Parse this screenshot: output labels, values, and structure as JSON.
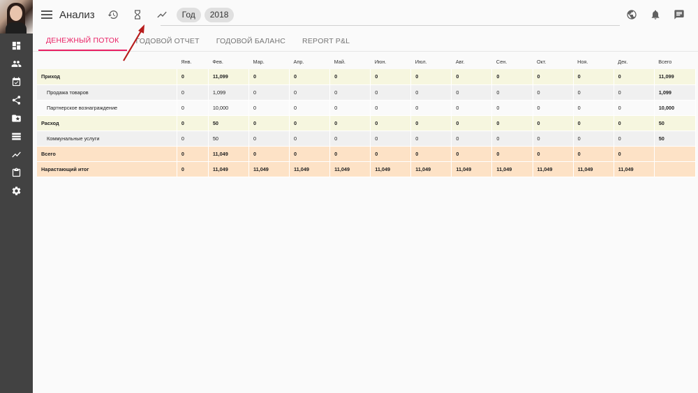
{
  "header": {
    "title": "Анализ",
    "chips": [
      "Год",
      "2018"
    ]
  },
  "tabs": [
    {
      "label": "ДЕНЕЖНЫЙ ПОТОК",
      "active": true
    },
    {
      "label": "ГОДОВОЙ ОТЧЕТ",
      "active": false
    },
    {
      "label": "ГОДОВОЙ БАЛАНС",
      "active": false
    },
    {
      "label": "REPORT P&L",
      "active": false
    }
  ],
  "table": {
    "columns": [
      "Янв.",
      "Фев.",
      "Мар.",
      "Апр.",
      "Май.",
      "Июн.",
      "Июл.",
      "Авг.",
      "Сен.",
      "Окт.",
      "Ноя.",
      "Дек.",
      "Всего"
    ],
    "rows": [
      {
        "label": "Приход",
        "kind": "cat",
        "values": [
          "0",
          "11,099",
          "0",
          "0",
          "0",
          "0",
          "0",
          "0",
          "0",
          "0",
          "0",
          "0",
          "11,099"
        ]
      },
      {
        "label": "Продажа товаров",
        "kind": "sub",
        "values": [
          "0",
          "1,099",
          "0",
          "0",
          "0",
          "0",
          "0",
          "0",
          "0",
          "0",
          "0",
          "0",
          "1,099"
        ]
      },
      {
        "label": "Партнерское вознаграждение",
        "kind": "sub-alt",
        "values": [
          "0",
          "10,000",
          "0",
          "0",
          "0",
          "0",
          "0",
          "0",
          "0",
          "0",
          "0",
          "0",
          "10,000"
        ]
      },
      {
        "label": "Расход",
        "kind": "cat",
        "values": [
          "0",
          "50",
          "0",
          "0",
          "0",
          "0",
          "0",
          "0",
          "0",
          "0",
          "0",
          "0",
          "50"
        ]
      },
      {
        "label": "Коммунальные услуги",
        "kind": "sub",
        "values": [
          "0",
          "50",
          "0",
          "0",
          "0",
          "0",
          "0",
          "0",
          "0",
          "0",
          "0",
          "0",
          "50"
        ]
      },
      {
        "label": "Всего",
        "kind": "total",
        "values": [
          "0",
          "11,049",
          "0",
          "0",
          "0",
          "0",
          "0",
          "0",
          "0",
          "0",
          "0",
          "0",
          ""
        ]
      },
      {
        "label": "Нарастающий итог",
        "kind": "total",
        "values": [
          "0",
          "11,049",
          "11,049",
          "11,049",
          "11,049",
          "11,049",
          "11,049",
          "11,049",
          "11,049",
          "11,049",
          "11,049",
          "11,049",
          ""
        ]
      }
    ]
  },
  "colors": {
    "accent": "#e91e63",
    "sidebar": "#424242",
    "category_row": "#f6f6df",
    "total_row": "#fde2c6",
    "annotation_arrow": "#b71c1c"
  }
}
